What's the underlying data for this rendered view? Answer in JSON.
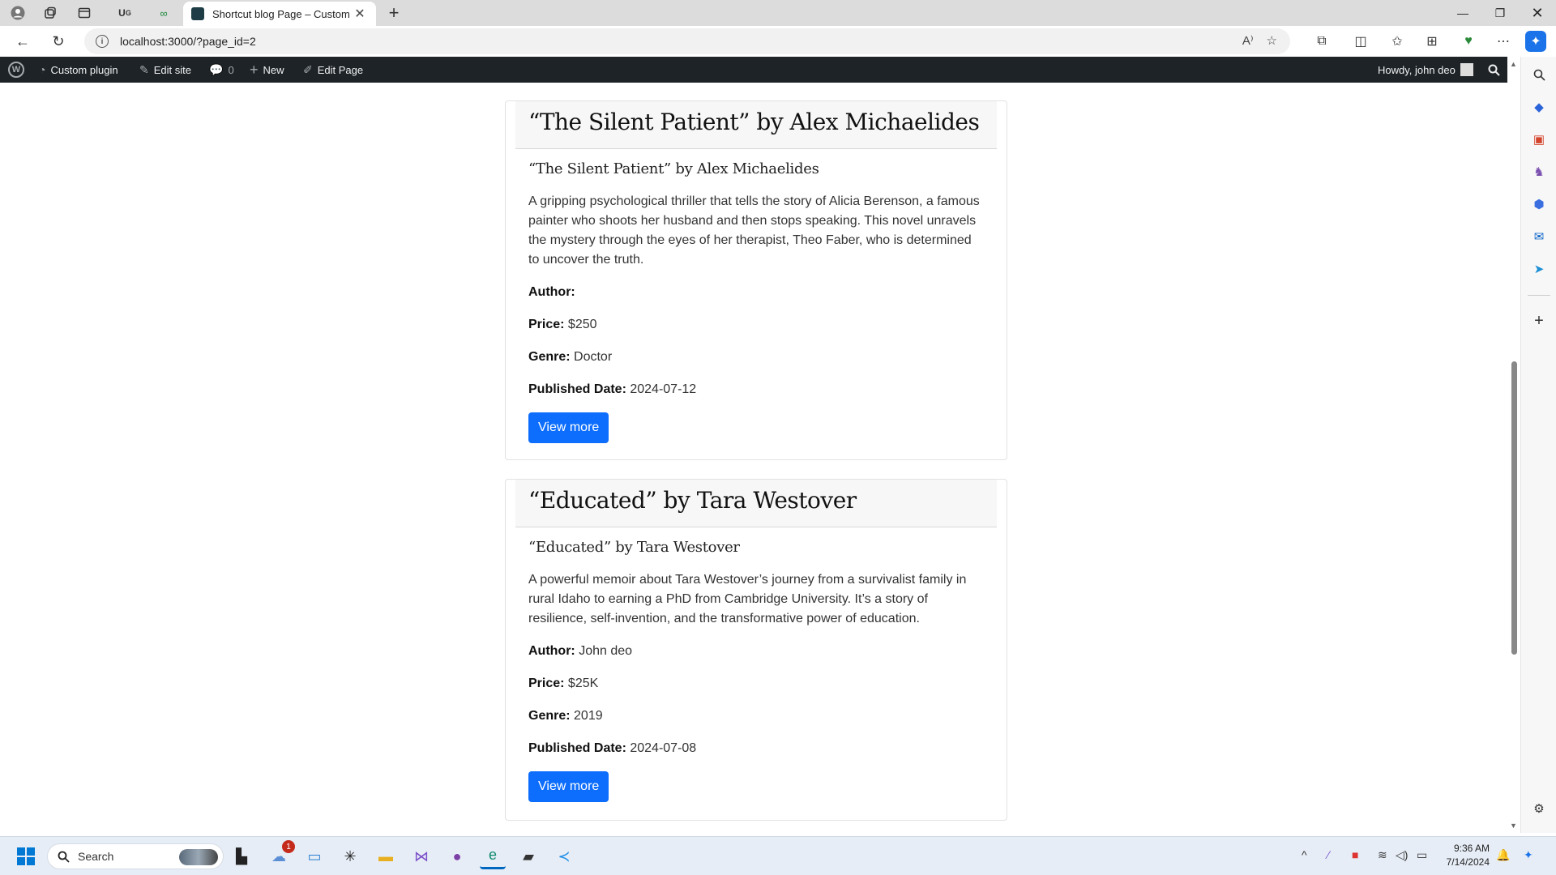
{
  "browser": {
    "active_tab_title": "Shortcut blog Page – Custom plugin",
    "url": "localhost:3000/?page_id=2",
    "read_aloud_label": "A⁾"
  },
  "wp_admin_bar": {
    "site_name": "Custom plugin",
    "edit_site": "Edit site",
    "comments_count": "0",
    "new_label": "New",
    "edit_page": "Edit Page",
    "howdy": "Howdy, john deo"
  },
  "books": [
    {
      "title": "“The Silent Patient” by Alex Michaelides",
      "subtitle": "“The Silent Patient” by Alex Michaelides",
      "description": "A gripping psychological thriller that tells the story of Alicia Berenson, a famous painter who shoots her husband and then stops speaking. This novel unravels the mystery through the eyes of her therapist, Theo Faber, who is determined to uncover the truth.",
      "author_label": "Author:",
      "author": "",
      "price_label": "Price:",
      "price": "$250",
      "genre_label": "Genre:",
      "genre": "Doctor",
      "date_label": "Published Date:",
      "date": "2024-07-12",
      "button": "View more"
    },
    {
      "title": "“Educated” by Tara Westover",
      "subtitle": "“Educated” by Tara Westover",
      "description": "A powerful memoir about Tara Westover’s journey from a survivalist family in rural Idaho to earning a PhD from Cambridge University. It’s a story of resilience, self-invention, and the transformative power of education.",
      "author_label": "Author:",
      "author": "John deo",
      "price_label": "Price:",
      "price": "$25K",
      "genre_label": "Genre:",
      "genre": "2019",
      "date_label": "Published Date:",
      "date": "2024-07-08",
      "button": "View more"
    }
  ],
  "taskbar": {
    "search_placeholder": "Search",
    "notification_badge": "1",
    "time": "9:36 AM",
    "date": "7/14/2024"
  },
  "colors": {
    "wp_bar": "#1d2327",
    "button_primary": "#0d6efd",
    "taskbar": "#e6edf6"
  }
}
